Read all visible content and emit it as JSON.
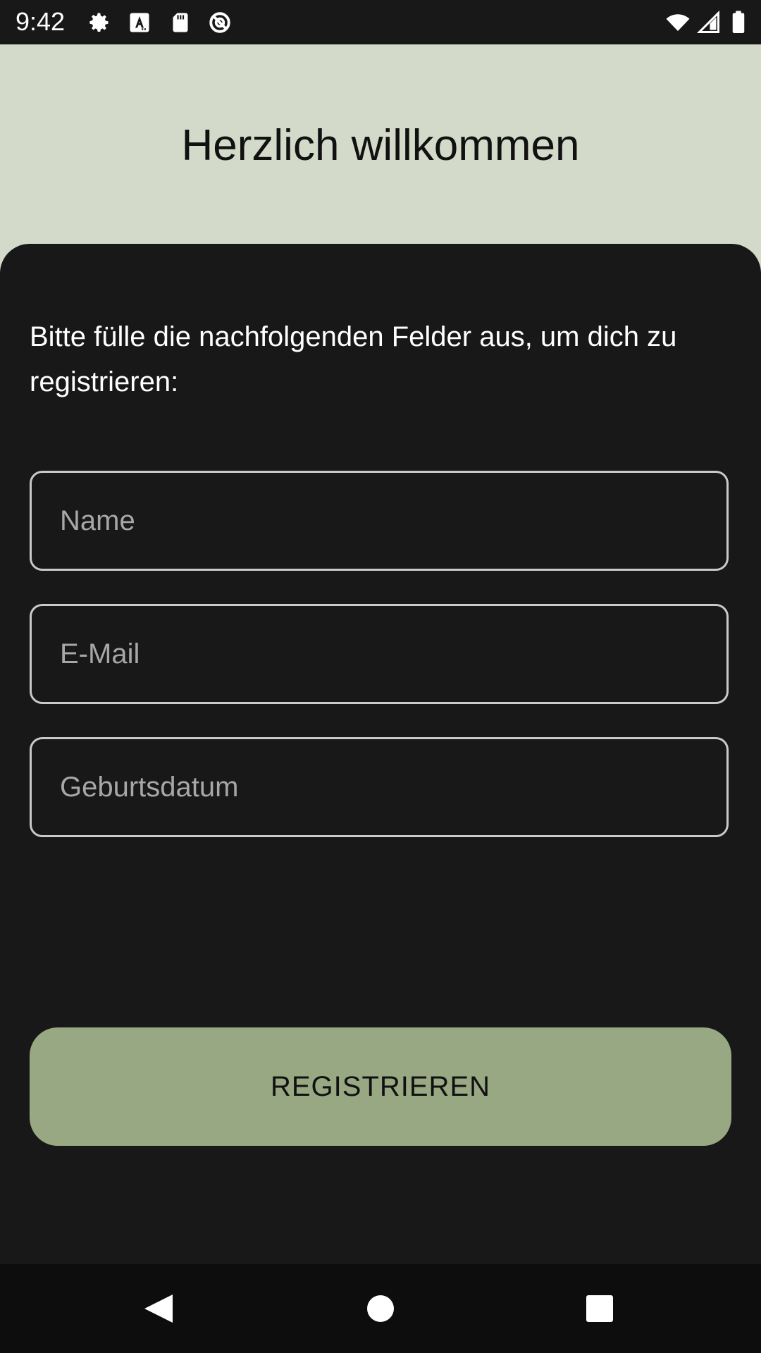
{
  "status_bar": {
    "time": "9:42",
    "icons": [
      "gear-icon",
      "font-a-icon",
      "sd-card-icon",
      "do-not-disturb-icon"
    ],
    "right_icons": [
      "wifi-icon",
      "signal-icon",
      "battery-icon"
    ]
  },
  "header": {
    "title": "Herzlich willkommen"
  },
  "form": {
    "intro": "Bitte fülle die nachfolgenden Felder aus, um dich zu registrieren:",
    "fields": [
      {
        "placeholder": "Name",
        "value": ""
      },
      {
        "placeholder": "E-Mail",
        "value": ""
      },
      {
        "placeholder": "Geburtsdatum",
        "value": ""
      }
    ],
    "submit_label": "REGISTRIEREN"
  },
  "nav_bar": {
    "buttons": [
      "back-icon",
      "home-icon",
      "recents-icon"
    ]
  },
  "colors": {
    "header_bg": "#d3dac9",
    "sheet_bg": "#181818",
    "accent": "#98a882",
    "field_border": "#c9c9c9"
  }
}
